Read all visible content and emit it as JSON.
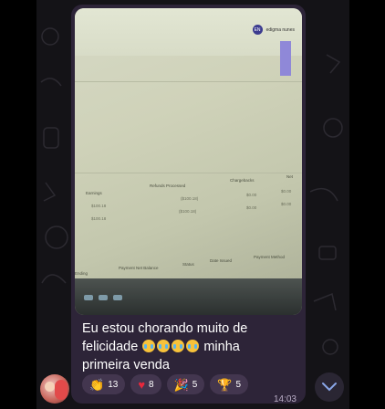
{
  "message": {
    "caption_line1": "Eu estou chorando muito de",
    "caption_line2_prefix": "felicidade",
    "caption_line2_suffix": "minha",
    "caption_line3": "primeira venda",
    "emoji_name": "crying-laughing-face",
    "timestamp": "14:03"
  },
  "photo": {
    "user_initials": "EN",
    "user_name": "edigma nunes",
    "row_labels": [
      "Earnings",
      "$100.18",
      "$100.18"
    ],
    "headers": [
      "Refunds Processed",
      "Chargebacks",
      "Net"
    ],
    "values": [
      "($100.18)",
      "($100.18)",
      "$0.00",
      "$0.00",
      "$0.00",
      "$0.00"
    ],
    "bottom_headers": [
      "Ending",
      "Payment Net Balance",
      "Status",
      "Date Issued",
      "Payment Method"
    ]
  },
  "reactions": [
    {
      "icon": "👏",
      "name": "clap",
      "count": "13"
    },
    {
      "icon": "♥",
      "name": "heart",
      "count": "8"
    },
    {
      "icon": "🎉",
      "name": "party",
      "count": "5"
    },
    {
      "icon": "🏆",
      "name": "trophy",
      "count": "5"
    }
  ],
  "colors": {
    "bubble": "#2d2438",
    "reaction_bg": "#43364f",
    "heart": "#e8283c",
    "trophy": "#f0a81c",
    "background": "#141317"
  }
}
